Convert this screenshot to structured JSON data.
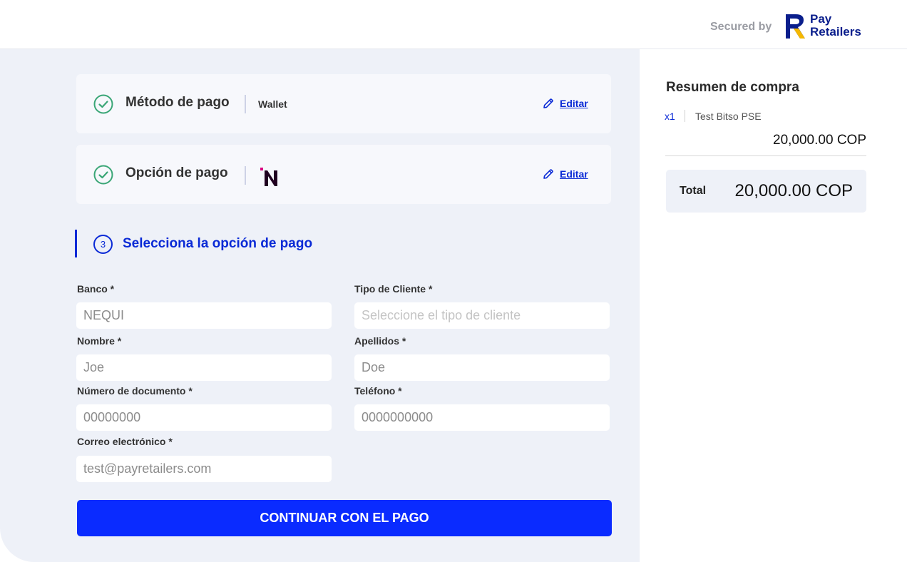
{
  "header": {
    "secured_label": "Secured by",
    "brand_line1": "Pay",
    "brand_line2": "Retailers",
    "brand_color": "#0a1e8c",
    "brand_accent": "#f5b800"
  },
  "steps": {
    "method": {
      "title": "Método de pago",
      "value": "Wallet",
      "edit_label": "Editar",
      "icon": "check-circle-icon"
    },
    "option": {
      "title": "Opción de pago",
      "logo": "nequi-logo",
      "edit_label": "Editar",
      "icon": "check-circle-icon"
    },
    "current": {
      "number": "3",
      "title": "Selecciona la opción de pago"
    }
  },
  "form": {
    "banco": {
      "label": "Banco *",
      "value": "NEQUI"
    },
    "tipo_cliente": {
      "label": "Tipo de Cliente *",
      "placeholder": "Seleccione el tipo de cliente"
    },
    "nombre": {
      "label": "Nombre *",
      "value": "Joe"
    },
    "apellidos": {
      "label": "Apellidos *",
      "value": "Doe"
    },
    "documento": {
      "label": "Número de documento *",
      "value": "00000000"
    },
    "telefono": {
      "label": "Teléfono *",
      "value": "0000000000"
    },
    "correo": {
      "label": "Correo electrónico *",
      "value": "test@payretailers.com"
    },
    "submit_label": "CONTINUAR CON EL PAGO"
  },
  "summary": {
    "title": "Resumen de compra",
    "items": [
      {
        "qty": "x1",
        "name": "Test Bitso PSE",
        "price": "20,000.00 COP"
      }
    ],
    "total_label": "Total",
    "total_value": "20,000.00 COP"
  },
  "colors": {
    "primary": "#0a2bff",
    "accent_text": "#0a2ad6",
    "success": "#3aa676",
    "panel_bg": "#eef1f8"
  }
}
